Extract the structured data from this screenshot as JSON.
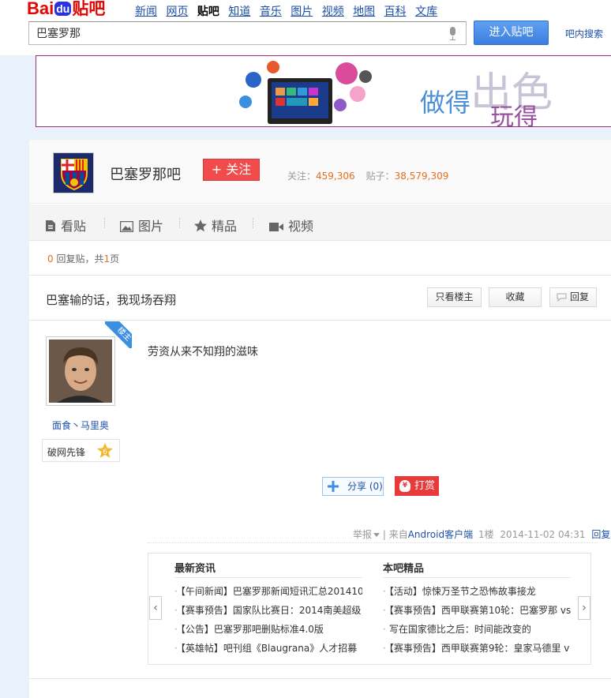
{
  "header": {
    "logo": {
      "part1": "Bai",
      "paw": "du",
      "part2": "贴吧"
    },
    "nav": [
      "新闻",
      "网页",
      "贴吧",
      "知道",
      "音乐",
      "图片",
      "视频",
      "地图",
      "百科",
      "文库"
    ],
    "search_value": "巴塞罗那",
    "enter_button": "进入贴吧",
    "in_forum_search": "吧内搜索"
  },
  "banner": {
    "text_small": "做得",
    "text_big": "出色",
    "text_line2": "玩得"
  },
  "forum": {
    "name": "巴塞罗那吧",
    "follow_label": "+ 关注",
    "followers_label": "关注：",
    "followers": "459,306",
    "posts_label": "贴子：",
    "posts": "38,579,309"
  },
  "tabs": [
    {
      "label": "看贴",
      "icon": "document-icon"
    },
    {
      "label": "图片",
      "icon": "image-icon"
    },
    {
      "label": "精品",
      "icon": "star-icon"
    },
    {
      "label": "视频",
      "icon": "video-icon"
    }
  ],
  "pager": {
    "replies": "0",
    "replies_text": "回复贴，共",
    "pages": "1",
    "pages_text": "页"
  },
  "thread": {
    "title": "巴塞输的话，我现场吞翔",
    "only_op": "只看楼主",
    "favorite": "收藏",
    "reply": "回复"
  },
  "post": {
    "owner_tag": "楼主",
    "username": "面食丶马里奥",
    "level_title": "破网先锋",
    "level": "6",
    "content": "劳资从来不知翔的滋味",
    "share_label": "分享",
    "share_count": "(0)",
    "reward_label": "打赏",
    "reward_icon": "¥",
    "report": "举报",
    "source_prefix": "| 来自",
    "source": "Android客户端",
    "floor": "1楼",
    "time": "2014-11-02 04:31",
    "reply_link": "回复"
  },
  "recommend": {
    "left_arrow": "‹",
    "right_arrow": "›",
    "col1_title": "最新资讯",
    "col1_items": [
      "【午间新闻】巴塞罗那新闻短讯汇总201410",
      "【赛事预告】国家队比赛日：2014南美超级",
      "【公告】巴塞罗那吧删贴标准4.0版",
      "【英雄帖】吧刊组《Blaugrana》人才招募"
    ],
    "col2_title": "本吧精品",
    "col2_items": [
      "【活动】惊悚万圣节之恐怖故事接龙",
      "【赛事预告】西甲联赛第10轮：巴塞罗那 vs",
      "写在国家德比之后：时间能改变的",
      "【赛事预告】西甲联赛第9轮：皇家马德里 v"
    ]
  },
  "colors": {
    "accent": "#3a7fe0",
    "follow": "#f24b4b",
    "link": "#1e4fa8",
    "number": "#e86d1e"
  }
}
